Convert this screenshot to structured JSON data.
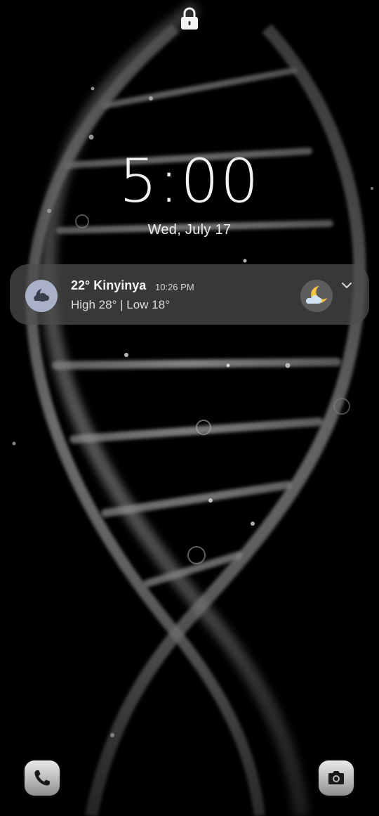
{
  "lockscreen": {
    "lock_icon": "lock-icon",
    "clock": "5:00",
    "date": "Wed, July 17"
  },
  "notification": {
    "app_icon": "weather-app-icon",
    "title": "22° Kinyinya",
    "time": "10:26 PM",
    "body": "High 28° | Low 18°",
    "condition_icon": "partly-cloudy-night-icon",
    "expand_icon": "chevron-down-icon"
  },
  "shortcuts": {
    "left": "phone-icon",
    "right": "camera-icon"
  },
  "colors": {
    "background": "#000000",
    "notification_bg": "#4e4e4e",
    "app_icon_bg": "#a9b1c8",
    "moon": "#f5c242"
  }
}
